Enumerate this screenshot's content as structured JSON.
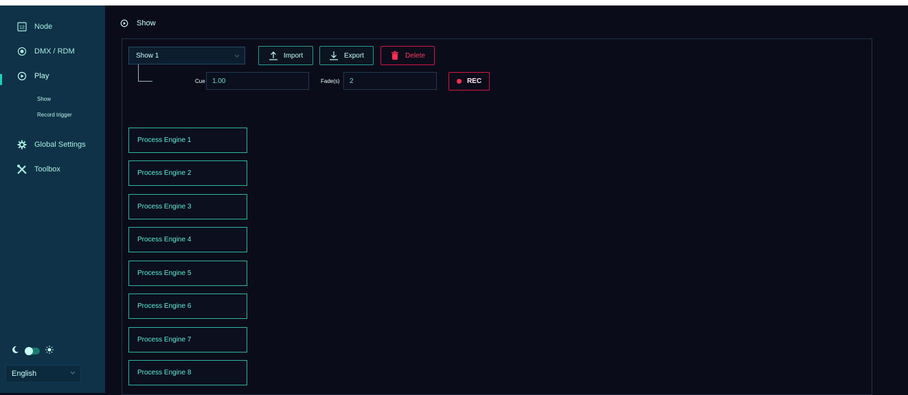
{
  "sidebar": {
    "items": [
      {
        "label": "Node",
        "icon": "node-calendar-icon"
      },
      {
        "label": "DMX / RDM",
        "icon": "radio-target-icon"
      },
      {
        "label": "Play",
        "icon": "play-circle-icon"
      },
      {
        "label": "Global Settings",
        "icon": "gear-icon"
      },
      {
        "label": "Toolbox",
        "icon": "tools-icon"
      }
    ],
    "sub_items": [
      "Show",
      "Record trigger"
    ],
    "language": "English",
    "node_icon_text": "12"
  },
  "header": {
    "breadcrumb": "Show"
  },
  "toolbar": {
    "show_select": "Show 1",
    "import_label": "Import",
    "export_label": "Export",
    "delete_label": "Delete"
  },
  "cue": {
    "cue_label": "Cue",
    "cue_value": "1.00",
    "fade_label": "Fade(s)",
    "fade_value": "2",
    "rec_label": "REC"
  },
  "engines": [
    "Process Engine 1",
    "Process Engine 2",
    "Process Engine 3",
    "Process Engine 4",
    "Process Engine 5",
    "Process Engine 6",
    "Process Engine 7",
    "Process Engine 8"
  ],
  "colors": {
    "accent": "#19d4b8",
    "danger": "#d01841",
    "sidebar_bg": "#0f3248",
    "page_bg": "#0b0c1a"
  }
}
